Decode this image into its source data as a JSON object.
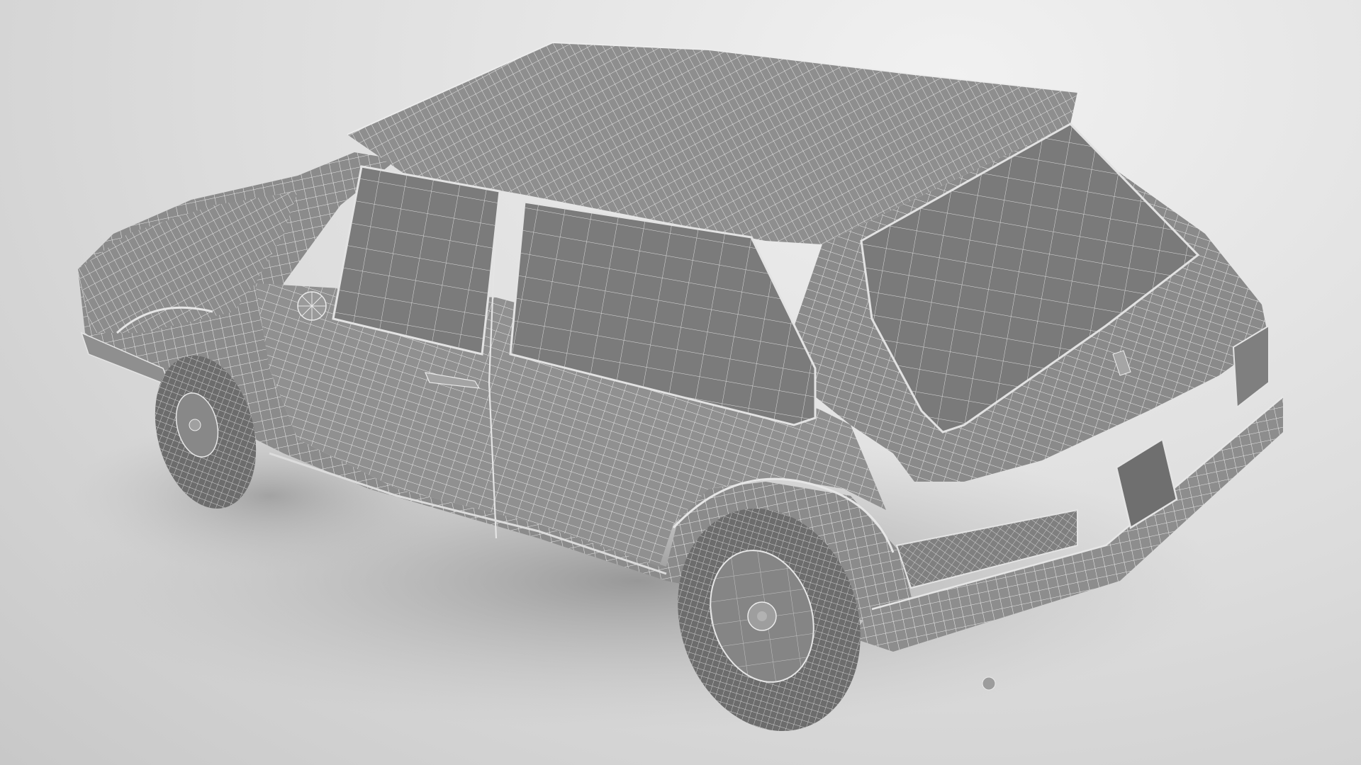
{
  "scene": {
    "subject": "car-wireframe-model",
    "palette": {
      "background_light": "#f1f1f1",
      "background_dark": "#c8c8c8",
      "body": "#8a8a8a",
      "glass": "#7e7e7e",
      "wire": "#e6e6e6",
      "shadow": "#9b9b9b",
      "tire": "#6c6c6c"
    }
  }
}
